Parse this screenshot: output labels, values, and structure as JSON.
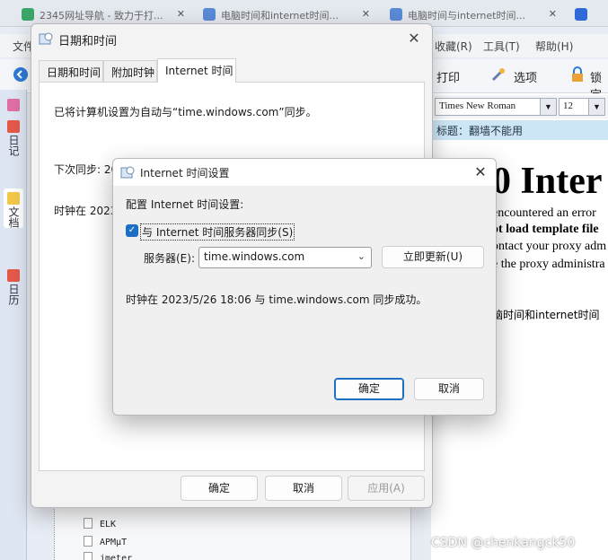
{
  "background": {
    "tabs": [
      {
        "label": "2345网址导航 - 致力于打..."
      },
      {
        "label": "电脑时间和internet时间..."
      },
      {
        "label": "电脑时间与internet时间..."
      }
    ],
    "menus": [
      "文件",
      "收藏(R)",
      "工具(T)",
      "帮助(H)"
    ],
    "toolbar": {
      "print": "打印",
      "options": "选项",
      "lock": "锁定"
    },
    "sidebar": [
      {
        "label": "日记"
      },
      {
        "label": "文档"
      },
      {
        "label": "日历"
      }
    ],
    "tree": [
      "ELK",
      "APMμT",
      "jmeter"
    ],
    "font_name": "Times New Roman",
    "font_size": "12",
    "doc_title_bar": "标题：翻墙不能用",
    "doc_big": "0 Inter",
    "doc_lines": [
      "encountered an error",
      "ot load template file",
      "ontact your proxy adm",
      "e the proxy administra",
      "脑时间和internet时间"
    ],
    "watermark": "CSDN @chenkangck50"
  },
  "dialog": {
    "title": "日期和时间",
    "tabs": [
      "日期和时间",
      "附加时钟",
      "Internet 时间"
    ],
    "auto_sync_text": "已将计算机设置为自动与“time.windows.com”同步。",
    "next_sync_text": "下次同步: 20",
    "clock_text": "时钟在 2023",
    "ok": "确定",
    "cancel": "取消",
    "apply": "应用(A)"
  },
  "inner": {
    "title": "Internet 时间设置",
    "config_label": "配置 Internet 时间设置:",
    "sync_checkbox_label": "与 Internet 时间服务器同步(S)",
    "sync_checked": true,
    "server_label": "服务器(E):",
    "server_value": "time.windows.com",
    "update_button": "立即更新(U)",
    "status_text": "时钟在 2023/5/26 18:06 与 time.windows.com 同步成功。",
    "ok": "确定",
    "cancel": "取消"
  }
}
